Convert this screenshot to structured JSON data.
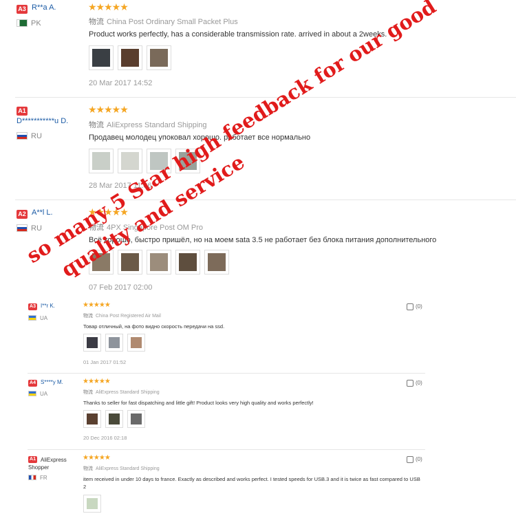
{
  "reviews": [
    {
      "level": "A3",
      "name": "R**a A.",
      "country": "PK",
      "stars": "★★★★★",
      "ship_tag": "物流",
      "shipping": "China Post Ordinary Small Packet Plus",
      "text": "Product works perfectly, has a considerable transmission rate. arrived in about a 2weeks.",
      "date": "20 Mar 2017 14:52",
      "photo_count": 3,
      "photo_colors": [
        "#3a3f44",
        "#5a3e2e",
        "#7a6a5a"
      ]
    },
    {
      "level": "A1",
      "name": "D***********u D.",
      "country": "RU",
      "stars": "★★★★★",
      "ship_tag": "物流",
      "shipping": "AliExpress Standard Shipping",
      "text": "Продавец молодец упоковал хорошо. работает все нормально",
      "date": "28 Mar 2017 11:06",
      "photo_count": 4,
      "photo_colors": [
        "#c9cfc8",
        "#d4d6cf",
        "#bfc6c2",
        "#9aa19a"
      ]
    },
    {
      "level": "A2",
      "name": "A**l L.",
      "country": "RU",
      "stars": "★★★★★",
      "ship_tag": "物流",
      "shipping": "4PX Singapore Post OM Pro",
      "text": "Всё хорошо, быстро пришёл, но на моем sata 3.5 не работает без блока питания дополнительного",
      "date": "07 Feb 2017 02:00",
      "photo_count": 5,
      "photo_colors": [
        "#8a7a66",
        "#6b5a48",
        "#9c8d7c",
        "#5e4e3e",
        "#7d6b5a"
      ]
    }
  ],
  "small_reviews": [
    {
      "level": "A3",
      "name": "I**r K.",
      "country": "UA",
      "stars": "★★★★★",
      "ship_tag": "物流",
      "shipping": "China Post Registered Air Mail",
      "text": "Товар отличный, на фото видно скорость передачи на ssd.",
      "date": "01 Jan 2017 01:52",
      "helpful": "(0)",
      "photo_count": 3,
      "photo_colors": [
        "#3b3b44",
        "#8e949c",
        "#b08a70"
      ]
    },
    {
      "level": "A4",
      "name": "S****y M.",
      "country": "UA",
      "stars": "★★★★★",
      "ship_tag": "物流",
      "shipping": "AliExpress Standard Shipping",
      "text": "Thanks to seller for fast dispatching and little gift! Product looks very high quality and works perfectly!",
      "date": "20 Dec 2016 02:18",
      "helpful": "(0)",
      "photo_count": 3,
      "photo_colors": [
        "#5a4030",
        "#4a4a3a",
        "#6a6a6a"
      ]
    },
    {
      "level": "A1",
      "name": "AliExpress Shopper",
      "country": "FR",
      "stars": "★★★★★",
      "ship_tag": "物流",
      "shipping": "AliExpress Standard Shipping",
      "text": "item received in under 10 days to france. Exactly as described and works perfect. I tested speeds for USB.3 and it is twice as fast compared to USB 2",
      "helpful": "(0)",
      "photo_count": 1,
      "photo_colors": [
        "#c8d8c0"
      ]
    }
  ],
  "watermark": {
    "line1": "so many 5 Star high feedback for our good",
    "line2": "quality and service",
    "color": "#e11b1b"
  }
}
